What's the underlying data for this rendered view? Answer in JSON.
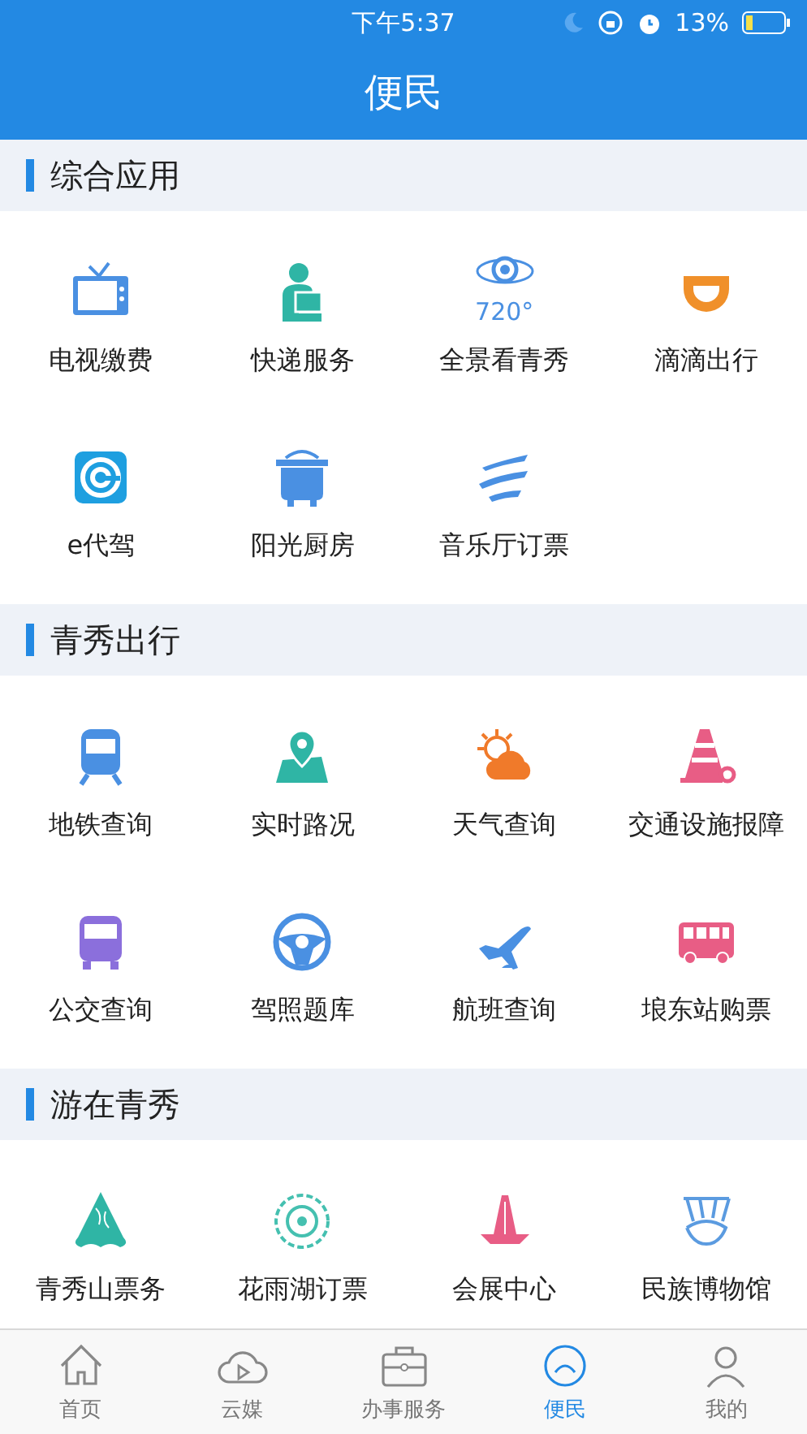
{
  "status_bar": {
    "time": "下午5:37",
    "battery": "13%"
  },
  "header": {
    "title": "便民"
  },
  "sections": [
    {
      "title": "综合应用",
      "items": [
        {
          "label": "电视缴费"
        },
        {
          "label": "快递服务"
        },
        {
          "label": "全景看青秀",
          "icon_text": "720°"
        },
        {
          "label": "滴滴出行"
        },
        {
          "label": "e代驾"
        },
        {
          "label": "阳光厨房"
        },
        {
          "label": "音乐厅订票"
        }
      ]
    },
    {
      "title": "青秀出行",
      "items": [
        {
          "label": "地铁查询"
        },
        {
          "label": "实时路况"
        },
        {
          "label": "天气查询"
        },
        {
          "label": "交通设施报障"
        },
        {
          "label": "公交查询"
        },
        {
          "label": "驾照题库"
        },
        {
          "label": "航班查询"
        },
        {
          "label": "埌东站购票"
        }
      ]
    },
    {
      "title": "游在青秀",
      "items": [
        {
          "label": "青秀山票务"
        },
        {
          "label": "花雨湖订票"
        },
        {
          "label": "会展中心"
        },
        {
          "label": "民族博物馆"
        }
      ]
    }
  ],
  "tab_bar": [
    {
      "label": "首页",
      "selected": false
    },
    {
      "label": "云媒",
      "selected": false
    },
    {
      "label": "办事服务",
      "selected": false
    },
    {
      "label": "便民",
      "selected": true
    },
    {
      "label": "我的",
      "selected": false
    }
  ]
}
